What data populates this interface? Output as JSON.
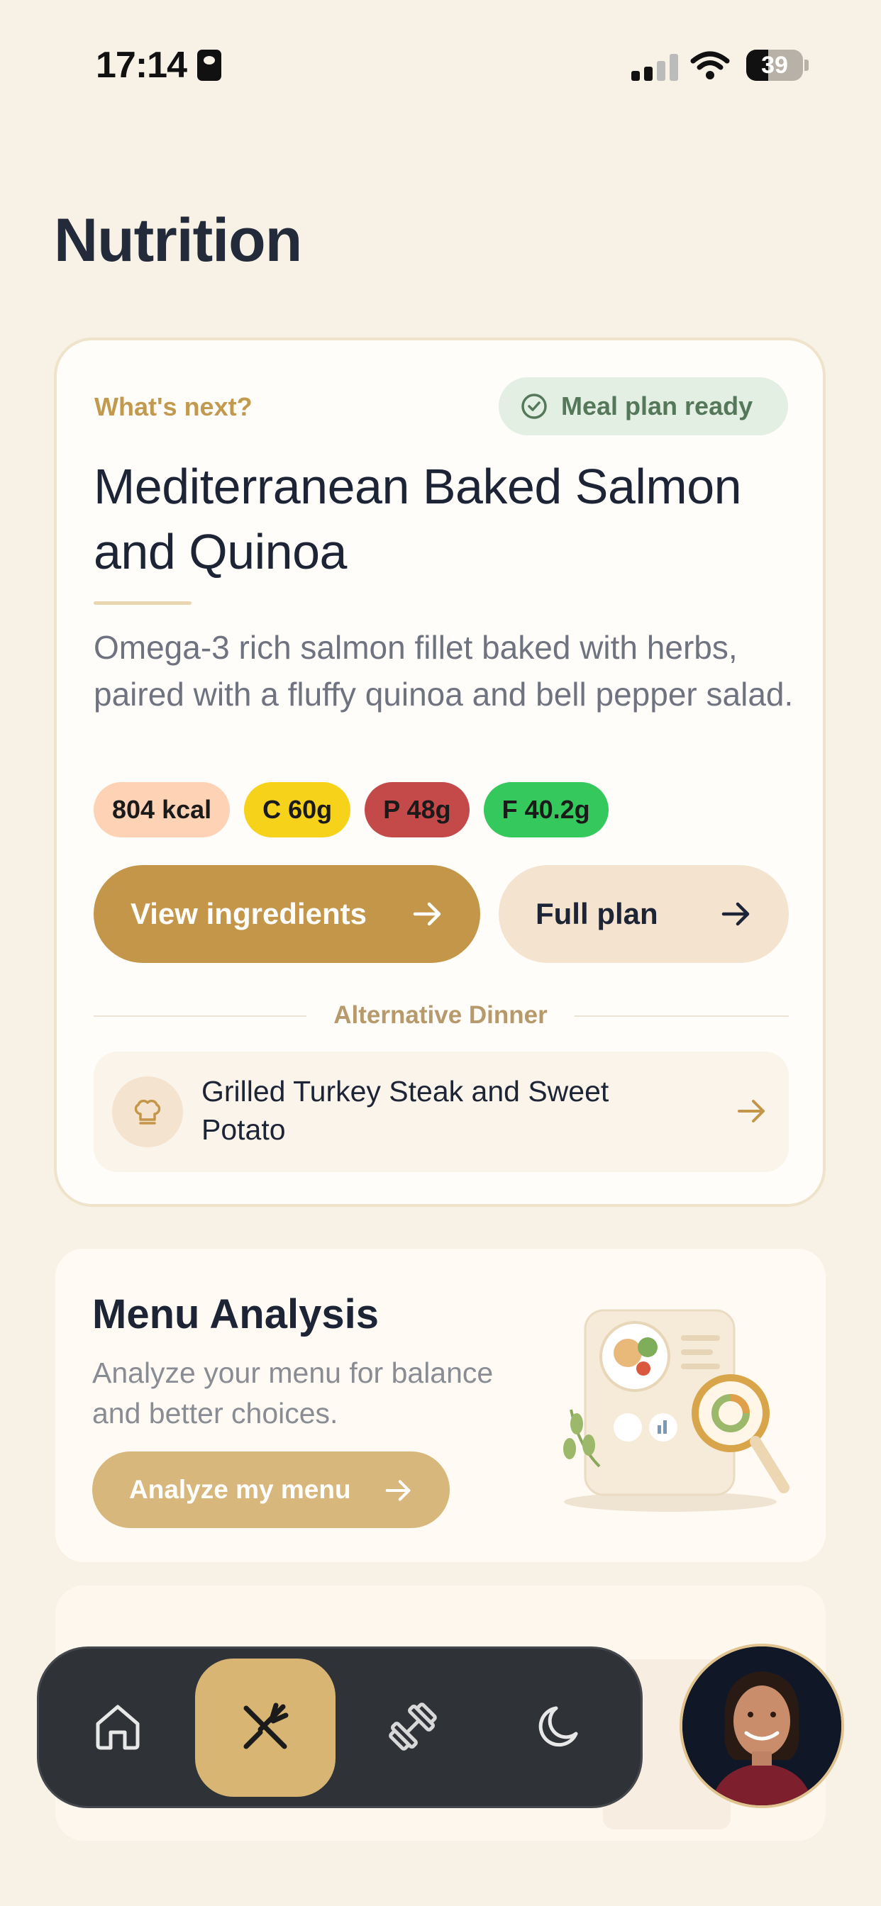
{
  "status_bar": {
    "time": "17:14",
    "battery": "39",
    "battery_level": 0.39
  },
  "page": {
    "title": "Nutrition"
  },
  "main_card": {
    "label": "What's next?",
    "badge": "Meal plan ready",
    "meal_title": "Mediterranean Baked Salmon and Quinoa",
    "description": "Omega-3 rich salmon fillet baked with herbs, paired with a fluffy quinoa and bell pepper salad.",
    "chips": [
      {
        "text": "804 kcal",
        "color": "#fdd2b5"
      },
      {
        "text": "C 60g",
        "color": "#f6d21a"
      },
      {
        "text": "P 48g",
        "color": "#c44a4a"
      },
      {
        "text": "F 40.2g",
        "color": "#35c85c"
      }
    ],
    "primary_button": "View ingredients",
    "secondary_button": "Full plan",
    "alternative_label": "Alternative Dinner",
    "alternative_item": "Grilled Turkey Steak and Sweet Potato"
  },
  "analysis_card": {
    "title": "Menu Analysis",
    "description": "Analyze your menu for balance and better choices.",
    "button": "Analyze my menu"
  },
  "nav": {
    "items": [
      "home-icon",
      "utensils-icon",
      "dumbbell-icon",
      "moon-icon"
    ],
    "active": "utensils-icon"
  },
  "colors": {
    "background": "#f8f1e6",
    "accent": "#c4964a",
    "nav_bg": "#2f3338",
    "nav_active": "#d8b572"
  }
}
